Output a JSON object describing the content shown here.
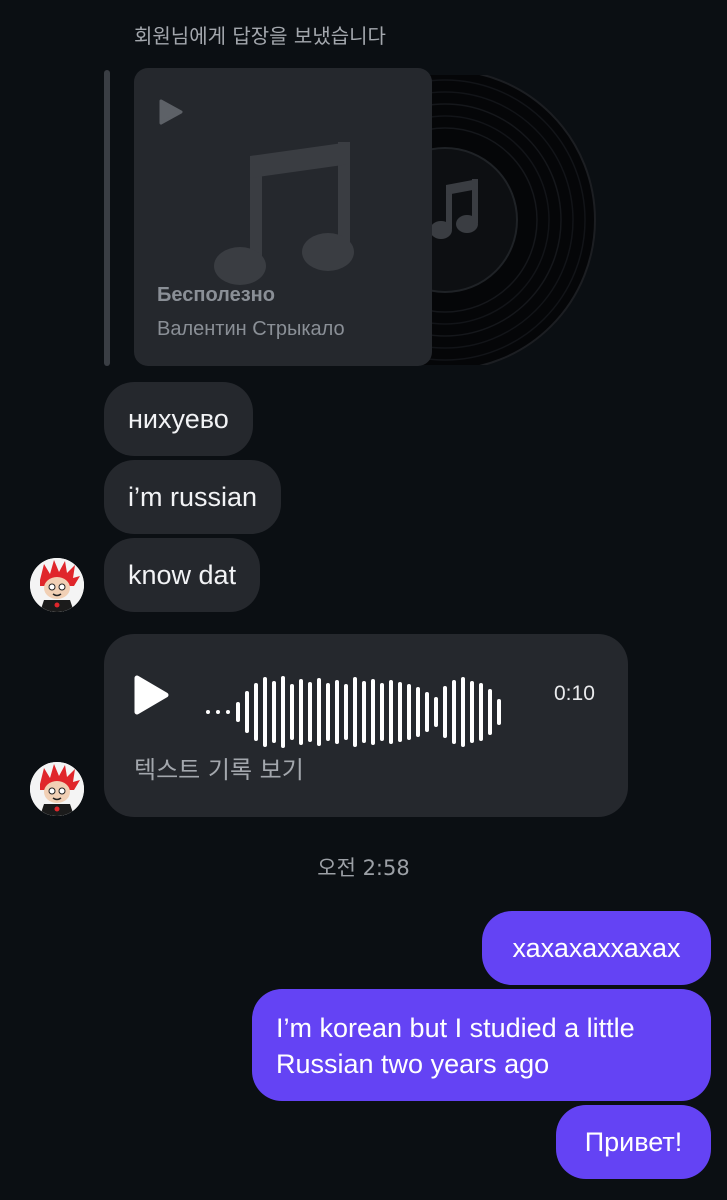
{
  "reply_note": "회원님에게 답장을 보냈습니다",
  "music_share": {
    "title": "Бесполезно",
    "artist": "Валентин Стрыкало",
    "icon": "music-note-icon"
  },
  "incoming_messages": [
    {
      "text": "нихуево"
    },
    {
      "text": "i’m russian"
    },
    {
      "text": "know dat"
    }
  ],
  "voice_message": {
    "duration": "0:10",
    "transcript_link": "텍스트 기록 보기"
  },
  "timestamp": "오전 2:58",
  "outgoing_messages": [
    {
      "text": "хахахаххахах"
    },
    {
      "text": "I’m korean but I studied a little Russian two years ago"
    },
    {
      "text": "Привет!"
    }
  ],
  "colors": {
    "background": "#0b0f13",
    "incoming_bubble": "#25282d",
    "outgoing_bubble": "#6443f4",
    "avatar_accent": "#e0262b"
  }
}
